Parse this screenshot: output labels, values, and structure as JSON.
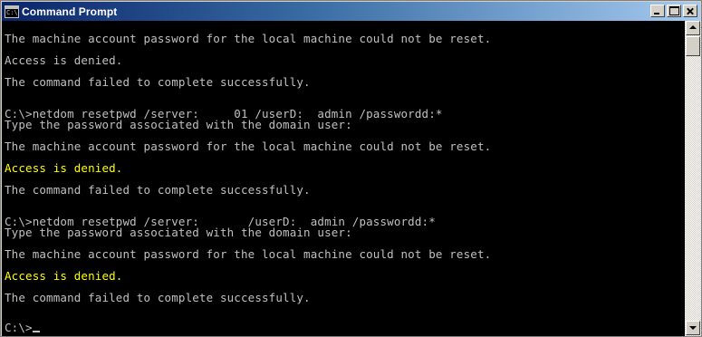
{
  "window": {
    "title": "Command Prompt",
    "icon": "console-icon",
    "icon_glyph": "C:\\",
    "colors": {
      "titlebar_start": "#0a246a",
      "titlebar_end": "#a6caf0",
      "console_bg": "#000000",
      "console_text": "#c0c0c0",
      "console_highlight": "#ffff00"
    }
  },
  "console": {
    "lines": [
      {
        "text": "The machine account password for the local machine could not be reset.",
        "color": "gray"
      },
      {
        "text": "Access is denied.",
        "color": "gray"
      },
      {
        "text": "The command failed to complete successfully.",
        "color": "gray"
      },
      {
        "text": "C:\\>netdom resetpwd /server:     01 /userD:  admin /passwordd:*",
        "color": "gray"
      },
      {
        "text": "Type the password associated with the domain user:",
        "color": "gray"
      },
      {
        "text": "The machine account password for the local machine could not be reset.",
        "color": "gray"
      },
      {
        "text": "Access is denied.",
        "color": "yellow"
      },
      {
        "text": "The command failed to complete successfully.",
        "color": "gray"
      },
      {
        "text": "C:\\>netdom resetpwd /server:       /userD:  admin /passwordd:*",
        "color": "gray"
      },
      {
        "text": "Type the password associated with the domain user:",
        "color": "gray"
      },
      {
        "text": "The machine account password for the local machine could not be reset.",
        "color": "gray"
      },
      {
        "text": "Access is denied.",
        "color": "yellow"
      },
      {
        "text": "The command failed to complete successfully.",
        "color": "gray"
      }
    ],
    "prompt": "C:\\>"
  }
}
